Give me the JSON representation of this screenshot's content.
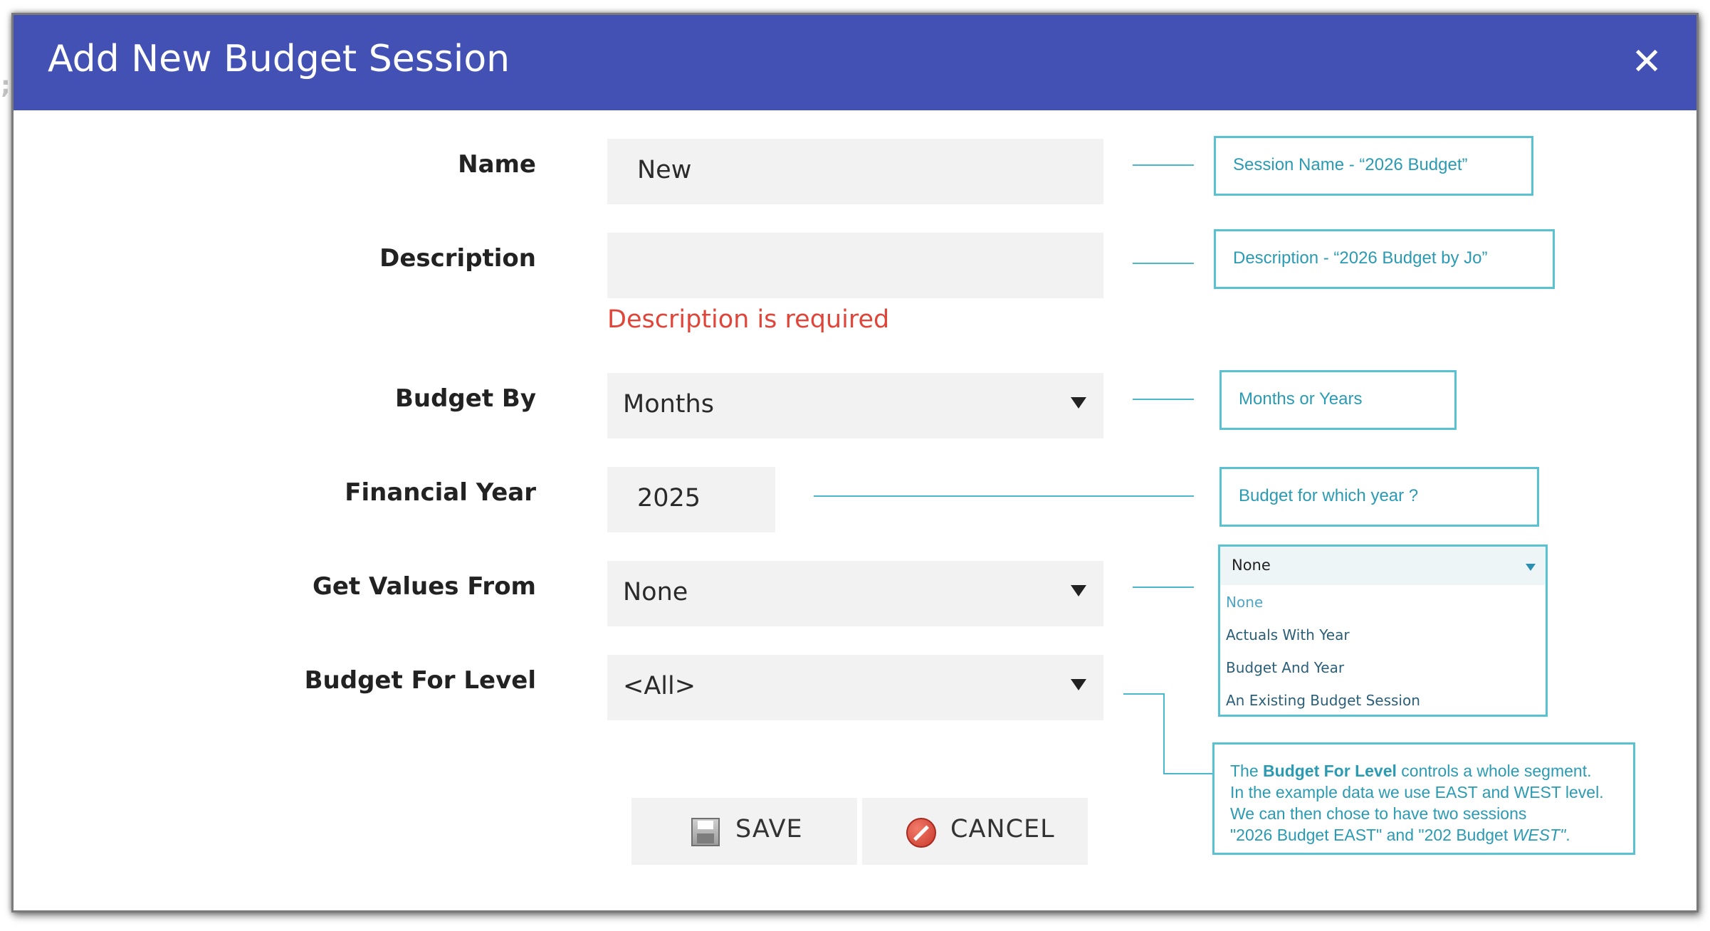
{
  "dialog": {
    "title": "Add New Budget Session",
    "close_glyph": "✕"
  },
  "form": {
    "name": {
      "label": "Name",
      "value": "New"
    },
    "description": {
      "label": "Description",
      "value": "",
      "error": "Description is required"
    },
    "budget_by": {
      "label": "Budget By",
      "value": "Months"
    },
    "financial_year": {
      "label": "Financial Year",
      "value": "2025"
    },
    "get_values_from": {
      "label": "Get Values From",
      "value": "None"
    },
    "budget_for_level": {
      "label": "Budget For Level",
      "value": "<All>"
    }
  },
  "buttons": {
    "save": "SAVE",
    "cancel": "CANCEL"
  },
  "notes": {
    "name": "Session Name - “2026 Budget”",
    "description": "Description - “2026 Budget by Jo”",
    "budget_by": "Months or Years",
    "financial_year": "Budget for which year ?",
    "level_line1_a": "The ",
    "level_line1_b": "Budget For Level",
    "level_line1_c": " controls a whole segment.",
    "level_line2": "In the example data we use EAST and WEST level.",
    "level_line3": "We can then chose to have two sessions",
    "level_line4_a": " \"2026 Budget EAST\" and \"202 Budget ",
    "level_line4_b": "WEST\"",
    "level_line4_c": "."
  },
  "values_dropdown": {
    "selected": "None",
    "options": [
      "None",
      "Actuals With Year",
      "Budget And Year",
      "An Existing Budget Session"
    ]
  },
  "colors": {
    "header": "#4251b3",
    "error": "#e0453a",
    "annotation": "#58c2d3"
  },
  "icons": {
    "close": "close-icon",
    "save": "floppy-disk-icon",
    "cancel": "cancel-circle-icon"
  }
}
